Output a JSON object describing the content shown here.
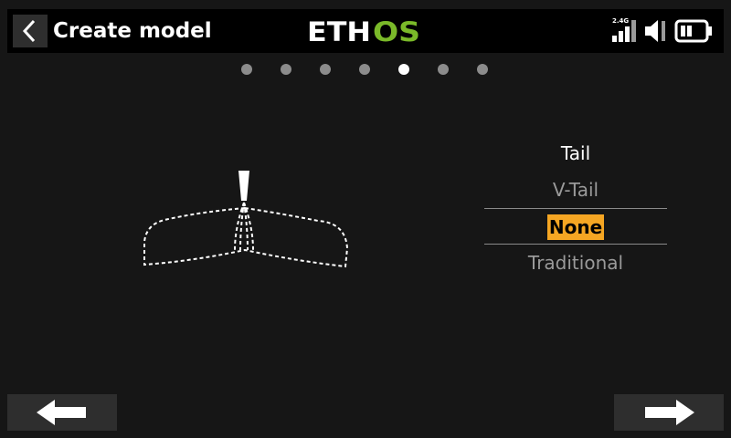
{
  "header": {
    "title": "Create model",
    "logo_text": "ETHOS",
    "back_icon": "chevron-left-icon",
    "rf_band": "2.4G",
    "icons": [
      "signal-bars-icon",
      "speaker-icon",
      "battery-icon"
    ]
  },
  "pagination": {
    "total": 7,
    "current": 5
  },
  "tail_selector": {
    "title": "Tail",
    "options": [
      "V-Tail",
      "None",
      "Traditional"
    ],
    "selected": "None"
  },
  "colors": {
    "accent": "#f5a623",
    "logo_green": "#7ab929",
    "background": "#161616"
  },
  "nav": {
    "prev_icon": "arrow-left-icon",
    "next_icon": "arrow-right-icon"
  }
}
